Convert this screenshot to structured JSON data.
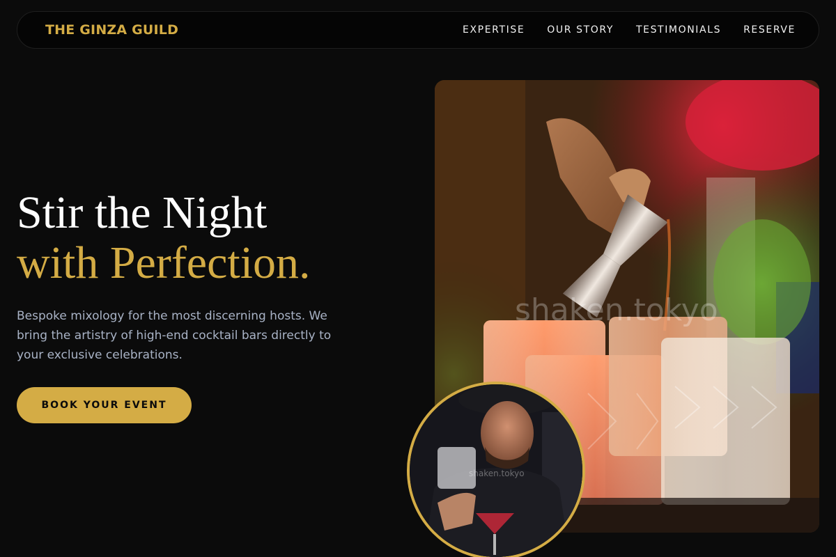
{
  "nav": {
    "brand": "THE GINZA GUILD",
    "links": [
      "EXPERTISE",
      "OUR STORY",
      "TESTIMONIALS",
      "RESERVE"
    ]
  },
  "hero": {
    "title_line1": "Stir the Night",
    "title_line2": "with Perfection.",
    "subtitle": "Bespoke mixology for the most discerning hosts. We bring the artistry of high-end cocktail bars directly to your exclusive celebrations.",
    "cta_label": "BOOK YOUR EVENT"
  },
  "images": {
    "main_watermark": "shaken.tokyo",
    "inset_watermark": "shaken.tokyo"
  },
  "colors": {
    "background": "#0b0b0b",
    "accent_gold": "#d4ac45",
    "subtitle_text": "#a9b3c6"
  }
}
